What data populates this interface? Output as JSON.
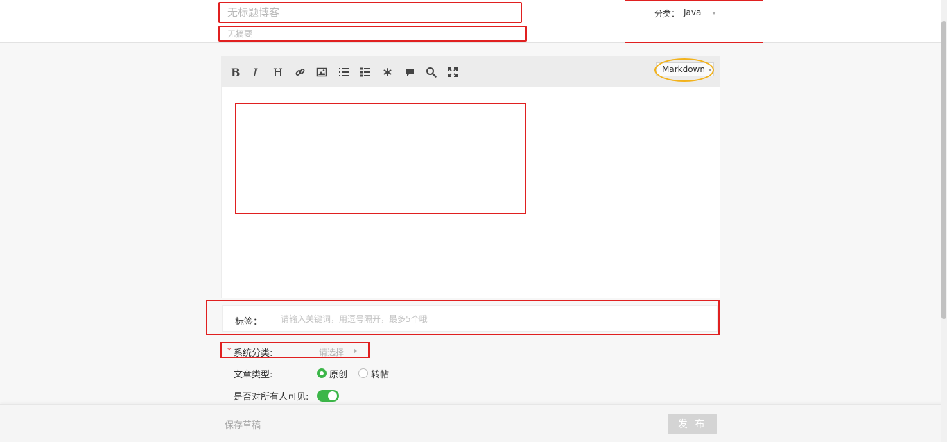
{
  "header": {
    "title_placeholder": "无标题博客",
    "summary_placeholder": "无摘要",
    "category_label": "分类：",
    "category_value": "Java"
  },
  "toolbar": {
    "buttons": [
      "bold-icon",
      "italic-icon",
      "heading-icon",
      "link-icon",
      "image-icon",
      "ordered-list-icon",
      "unordered-list-icon",
      "code-icon",
      "quote-icon",
      "search-icon",
      "fullscreen-icon"
    ],
    "mode": "Markdown"
  },
  "tags": {
    "label": "标签：",
    "placeholder": "请输入关键词，用逗号隔开，最多5个哦"
  },
  "system_category": {
    "required_mark": "*",
    "label": "系统分类:",
    "select_placeholder": "请选择"
  },
  "article_type": {
    "label": "文章类型:",
    "options": [
      "原创",
      "转帖"
    ],
    "selected": "原创"
  },
  "visibility": {
    "label": "是否对所有人可见:",
    "enabled": true
  },
  "footer": {
    "save_draft": "保存草稿",
    "publish": "发 布"
  },
  "colors": {
    "accent_green": "#3cb649",
    "highlight_red": "#e02020",
    "highlight_yellow": "#f2b21c"
  }
}
